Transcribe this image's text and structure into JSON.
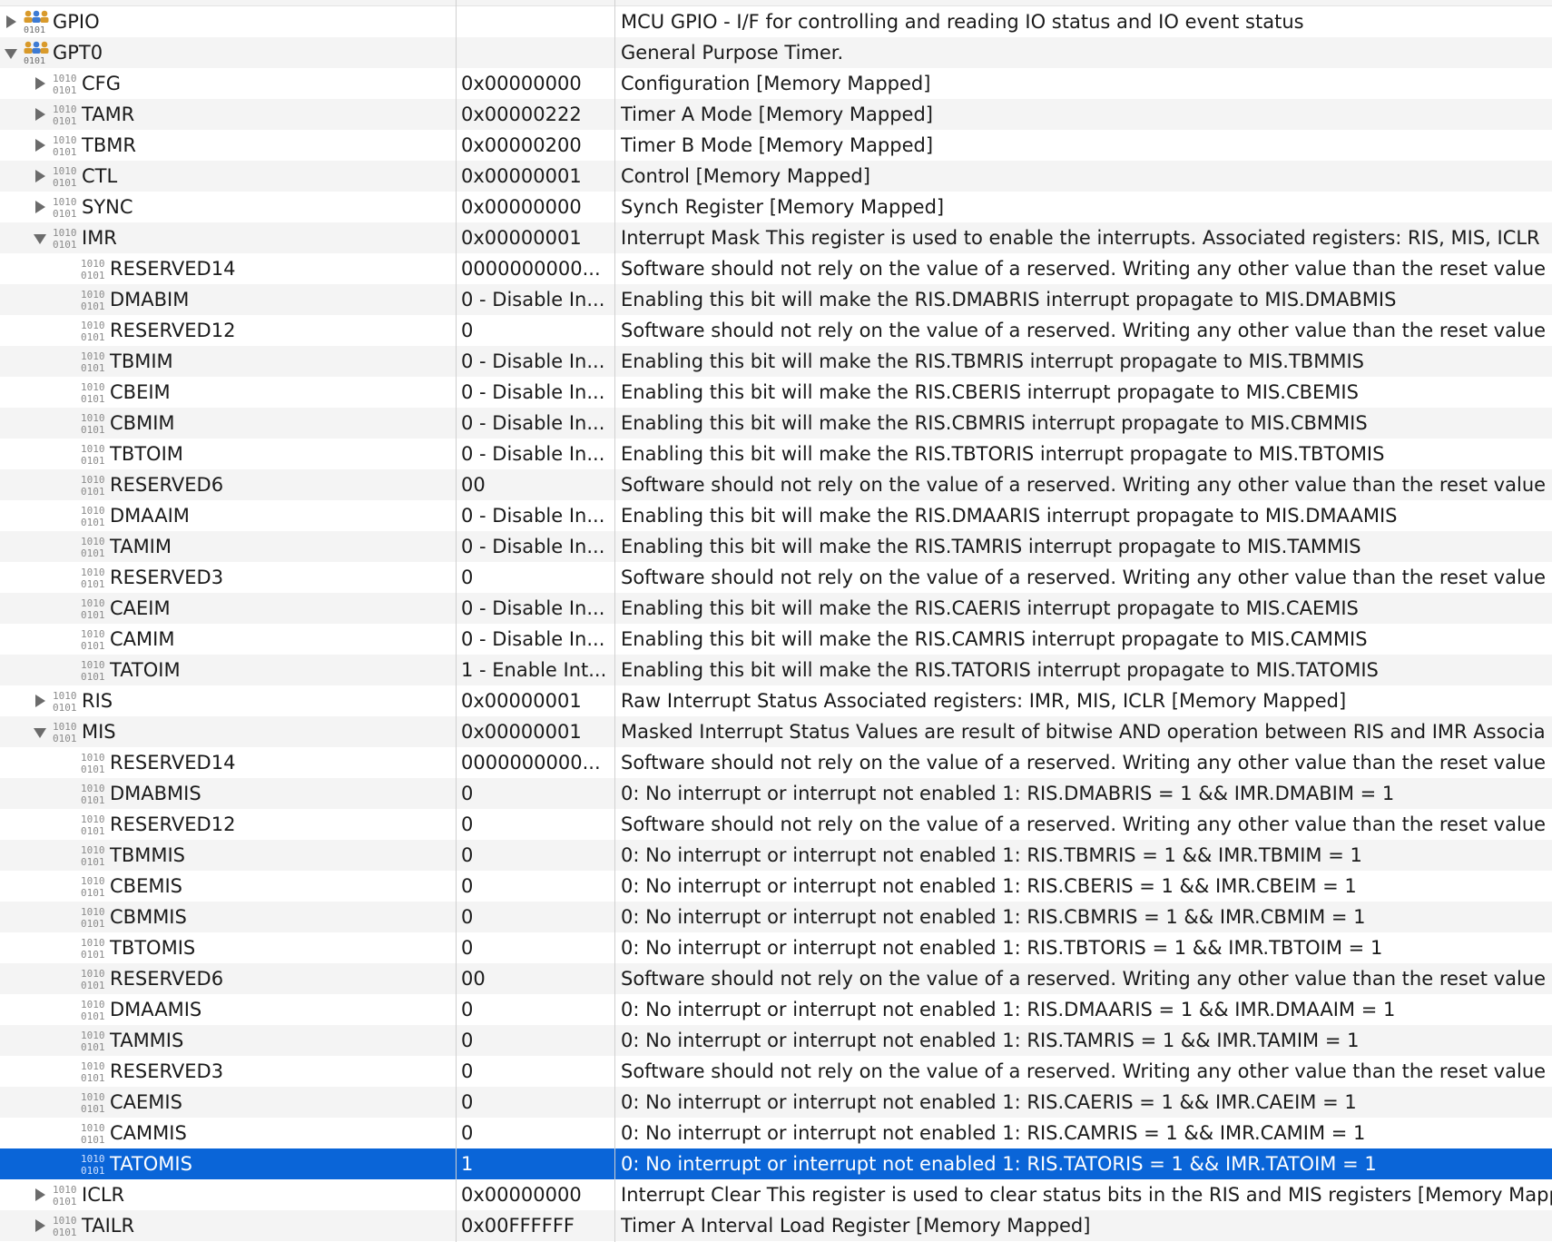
{
  "tree": {
    "rows": [
      {
        "name": "GPIO",
        "value": "",
        "description": "MCU GPIO - I/F for controlling and reading IO status and IO event status",
        "level": 0,
        "expander": "closed",
        "icon": "peripheral-icon"
      },
      {
        "name": "GPT0",
        "value": "",
        "description": "General Purpose Timer.",
        "level": 0,
        "expander": "open",
        "icon": "peripheral-icon"
      },
      {
        "name": "CFG",
        "value": "0x00000000",
        "description": "Configuration [Memory Mapped]",
        "level": 1,
        "expander": "closed",
        "icon": "register-icon"
      },
      {
        "name": "TAMR",
        "value": "0x00000222",
        "description": "Timer A Mode   [Memory Mapped]",
        "level": 1,
        "expander": "closed",
        "icon": "register-icon"
      },
      {
        "name": "TBMR",
        "value": "0x00000200",
        "description": "Timer B Mode   [Memory Mapped]",
        "level": 1,
        "expander": "closed",
        "icon": "register-icon"
      },
      {
        "name": "CTL",
        "value": "0x00000001",
        "description": "Control [Memory Mapped]",
        "level": 1,
        "expander": "closed",
        "icon": "register-icon"
      },
      {
        "name": "SYNC",
        "value": "0x00000000",
        "description": "Synch Register   [Memory Mapped]",
        "level": 1,
        "expander": "closed",
        "icon": "register-icon"
      },
      {
        "name": "IMR",
        "value": "0x00000001",
        "description": "Interrupt Mask This register is used to enable the interrupts. Associated registers: RIS, MIS, ICLR",
        "level": 1,
        "expander": "open",
        "icon": "register-icon"
      },
      {
        "name": "RESERVED14",
        "value": "0000000000...",
        "description": "Software should not rely on the value of a reserved. Writing any other value than the reset value m",
        "level": 2,
        "expander": "",
        "icon": "field-icon"
      },
      {
        "name": "DMABIM",
        "value": "0 - Disable In...",
        "description": "Enabling this bit will make the RIS.DMABRIS interrupt propagate to MIS.DMABMIS",
        "level": 2,
        "expander": "",
        "icon": "field-icon"
      },
      {
        "name": "RESERVED12",
        "value": "0",
        "description": "Software should not rely on the value of a reserved. Writing any other value than the reset value m",
        "level": 2,
        "expander": "",
        "icon": "field-icon"
      },
      {
        "name": "TBMIM",
        "value": "0 - Disable In...",
        "description": "Enabling this bit will make the RIS.TBMRIS interrupt propagate to MIS.TBMMIS",
        "level": 2,
        "expander": "",
        "icon": "field-icon"
      },
      {
        "name": "CBEIM",
        "value": "0 - Disable In...",
        "description": "Enabling this bit will make the RIS.CBERIS interrupt propagate to MIS.CBEMIS",
        "level": 2,
        "expander": "",
        "icon": "field-icon"
      },
      {
        "name": "CBMIM",
        "value": "0 - Disable In...",
        "description": "Enabling this bit will make the RIS.CBMRIS interrupt propagate to MIS.CBMMIS",
        "level": 2,
        "expander": "",
        "icon": "field-icon"
      },
      {
        "name": "TBTOIM",
        "value": "0 - Disable In...",
        "description": "Enabling this bit will make the RIS.TBTORIS interrupt propagate to MIS.TBTOMIS",
        "level": 2,
        "expander": "",
        "icon": "field-icon"
      },
      {
        "name": "RESERVED6",
        "value": "00",
        "description": "Software should not rely on the value of a reserved. Writing any other value than the reset value m",
        "level": 2,
        "expander": "",
        "icon": "field-icon"
      },
      {
        "name": "DMAAIM",
        "value": "0 - Disable In...",
        "description": "Enabling this bit will make the RIS.DMAARIS interrupt propagate to MIS.DMAAMIS",
        "level": 2,
        "expander": "",
        "icon": "field-icon"
      },
      {
        "name": "TAMIM",
        "value": "0 - Disable In...",
        "description": "Enabling this bit will make the RIS.TAMRIS interrupt propagate to MIS.TAMMIS",
        "level": 2,
        "expander": "",
        "icon": "field-icon"
      },
      {
        "name": "RESERVED3",
        "value": "0",
        "description": "Software should not rely on the value of a reserved. Writing any other value than the reset value m",
        "level": 2,
        "expander": "",
        "icon": "field-icon"
      },
      {
        "name": "CAEIM",
        "value": "0 - Disable In...",
        "description": "Enabling this bit will make the RIS.CAERIS interrupt propagate to MIS.CAEMIS",
        "level": 2,
        "expander": "",
        "icon": "field-icon"
      },
      {
        "name": "CAMIM",
        "value": "0 - Disable In...",
        "description": "Enabling this bit will make the RIS.CAMRIS interrupt propagate to MIS.CAMMIS",
        "level": 2,
        "expander": "",
        "icon": "field-icon"
      },
      {
        "name": "TATOIM",
        "value": "1 - Enable Int...",
        "description": "Enabling this bit will make the RIS.TATORIS interrupt propagate to MIS.TATOMIS",
        "level": 2,
        "expander": "",
        "icon": "field-icon"
      },
      {
        "name": "RIS",
        "value": "0x00000001",
        "description": "Raw Interrupt Status Associated registers: IMR, MIS, ICLR   [Memory Mapped]",
        "level": 1,
        "expander": "closed",
        "icon": "register-icon"
      },
      {
        "name": "MIS",
        "value": "0x00000001",
        "description": "Masked Interrupt Status Values are result of bitwise AND operation between RIS and IMR Associa",
        "level": 1,
        "expander": "open",
        "icon": "register-icon"
      },
      {
        "name": "RESERVED14",
        "value": "0000000000...",
        "description": "Software should not rely on the value of a reserved. Writing any other value than the reset value m",
        "level": 2,
        "expander": "",
        "icon": "field-icon"
      },
      {
        "name": "DMABMIS",
        "value": "0",
        "description": "0: No interrupt or interrupt not enabled 1: RIS.DMABRIS = 1 && IMR.DMABIM = 1",
        "level": 2,
        "expander": "",
        "icon": "field-icon"
      },
      {
        "name": "RESERVED12",
        "value": "0",
        "description": "Software should not rely on the value of a reserved. Writing any other value than the reset value m",
        "level": 2,
        "expander": "",
        "icon": "field-icon"
      },
      {
        "name": "TBMMIS",
        "value": "0",
        "description": "0: No interrupt or interrupt not enabled 1: RIS.TBMRIS = 1 && IMR.TBMIM = 1",
        "level": 2,
        "expander": "",
        "icon": "field-icon"
      },
      {
        "name": "CBEMIS",
        "value": "0",
        "description": "0: No interrupt or interrupt not enabled 1: RIS.CBERIS = 1 && IMR.CBEIM = 1",
        "level": 2,
        "expander": "",
        "icon": "field-icon"
      },
      {
        "name": "CBMMIS",
        "value": "0",
        "description": "0: No interrupt or interrupt not enabled 1: RIS.CBMRIS = 1 && IMR.CBMIM = 1",
        "level": 2,
        "expander": "",
        "icon": "field-icon"
      },
      {
        "name": "TBTOMIS",
        "value": "0",
        "description": "0: No interrupt or interrupt not enabled 1: RIS.TBTORIS = 1 && IMR.TBTOIM = 1",
        "level": 2,
        "expander": "",
        "icon": "field-icon"
      },
      {
        "name": "RESERVED6",
        "value": "00",
        "description": "Software should not rely on the value of a reserved. Writing any other value than the reset value m",
        "level": 2,
        "expander": "",
        "icon": "field-icon"
      },
      {
        "name": "DMAAMIS",
        "value": "0",
        "description": "0: No interrupt or interrupt not enabled 1: RIS.DMAARIS = 1 && IMR.DMAAIM = 1",
        "level": 2,
        "expander": "",
        "icon": "field-icon"
      },
      {
        "name": "TAMMIS",
        "value": "0",
        "description": "0: No interrupt or interrupt not enabled 1: RIS.TAMRIS = 1 && IMR.TAMIM = 1",
        "level": 2,
        "expander": "",
        "icon": "field-icon"
      },
      {
        "name": "RESERVED3",
        "value": "0",
        "description": "Software should not rely on the value of a reserved. Writing any other value than the reset value m",
        "level": 2,
        "expander": "",
        "icon": "field-icon"
      },
      {
        "name": "CAEMIS",
        "value": "0",
        "description": "0: No interrupt or interrupt not enabled 1: RIS.CAERIS = 1 && IMR.CAEIM = 1",
        "level": 2,
        "expander": "",
        "icon": "field-icon"
      },
      {
        "name": "CAMMIS",
        "value": "0",
        "description": "0: No interrupt or interrupt not enabled 1: RIS.CAMRIS = 1 && IMR.CAMIM = 1",
        "level": 2,
        "expander": "",
        "icon": "field-icon"
      },
      {
        "name": "TATOMIS",
        "value": "1",
        "description": "0: No interrupt or interrupt not enabled 1: RIS.TATORIS = 1 && IMR.TATOIM = 1",
        "level": 2,
        "expander": "",
        "icon": "field-icon",
        "selected": true
      },
      {
        "name": "ICLR",
        "value": "0x00000000",
        "description": "Interrupt Clear This register is used to clear status bits in the RIS and MIS registers [Memory Mapp",
        "level": 1,
        "expander": "closed",
        "icon": "register-icon"
      },
      {
        "name": "TAILR",
        "value": "0x00FFFFFF",
        "description": "Timer A Interval Load  Register [Memory Mapped]",
        "level": 1,
        "expander": "closed",
        "icon": "register-icon"
      }
    ]
  },
  "colors": {
    "selection": "#0a65d8",
    "stripe": "#f4f4f4",
    "peripheral_icon": "#d99a2b",
    "register_icon": "#8a8a8a"
  }
}
